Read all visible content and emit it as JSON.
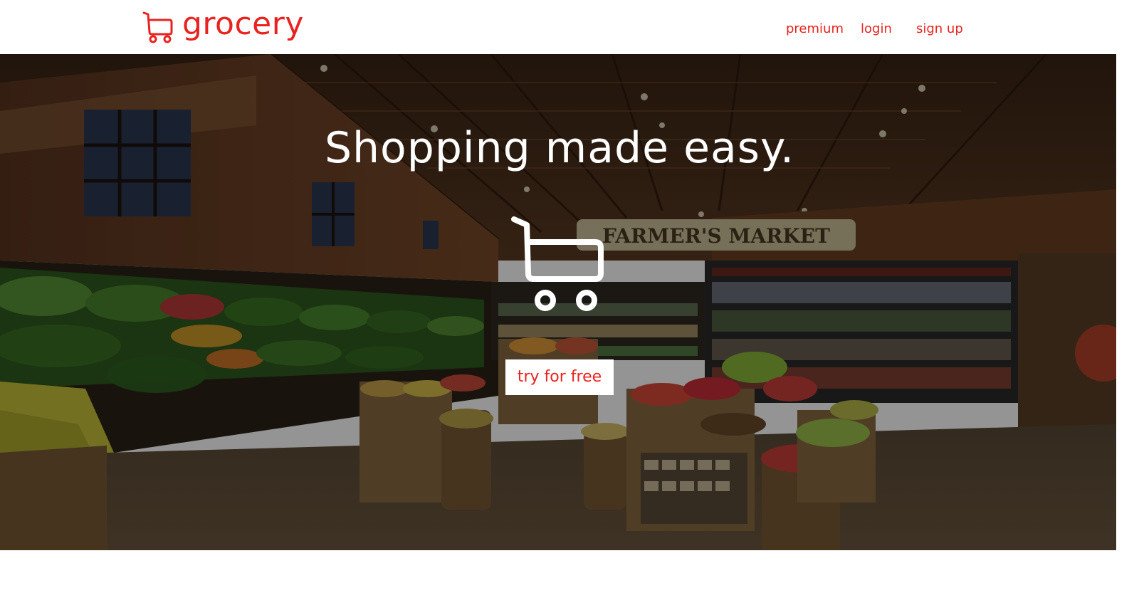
{
  "brand": {
    "name": "grocery",
    "icon": "shopping-cart-icon",
    "color": "#e8231f"
  },
  "nav": {
    "links": [
      {
        "label": "premium"
      },
      {
        "label": "login"
      },
      {
        "label": "sign up"
      }
    ]
  },
  "hero": {
    "title": "Shopping made easy.",
    "icon": "shopping-cart-icon",
    "background_image": "grocery-store-interior-farmers-market",
    "sign_text": "FARMER'S MARKET",
    "cta_label": "try for free"
  },
  "colors": {
    "accent": "#e8231f",
    "hero_text": "#ffffff",
    "page_background": "#ffffff"
  }
}
